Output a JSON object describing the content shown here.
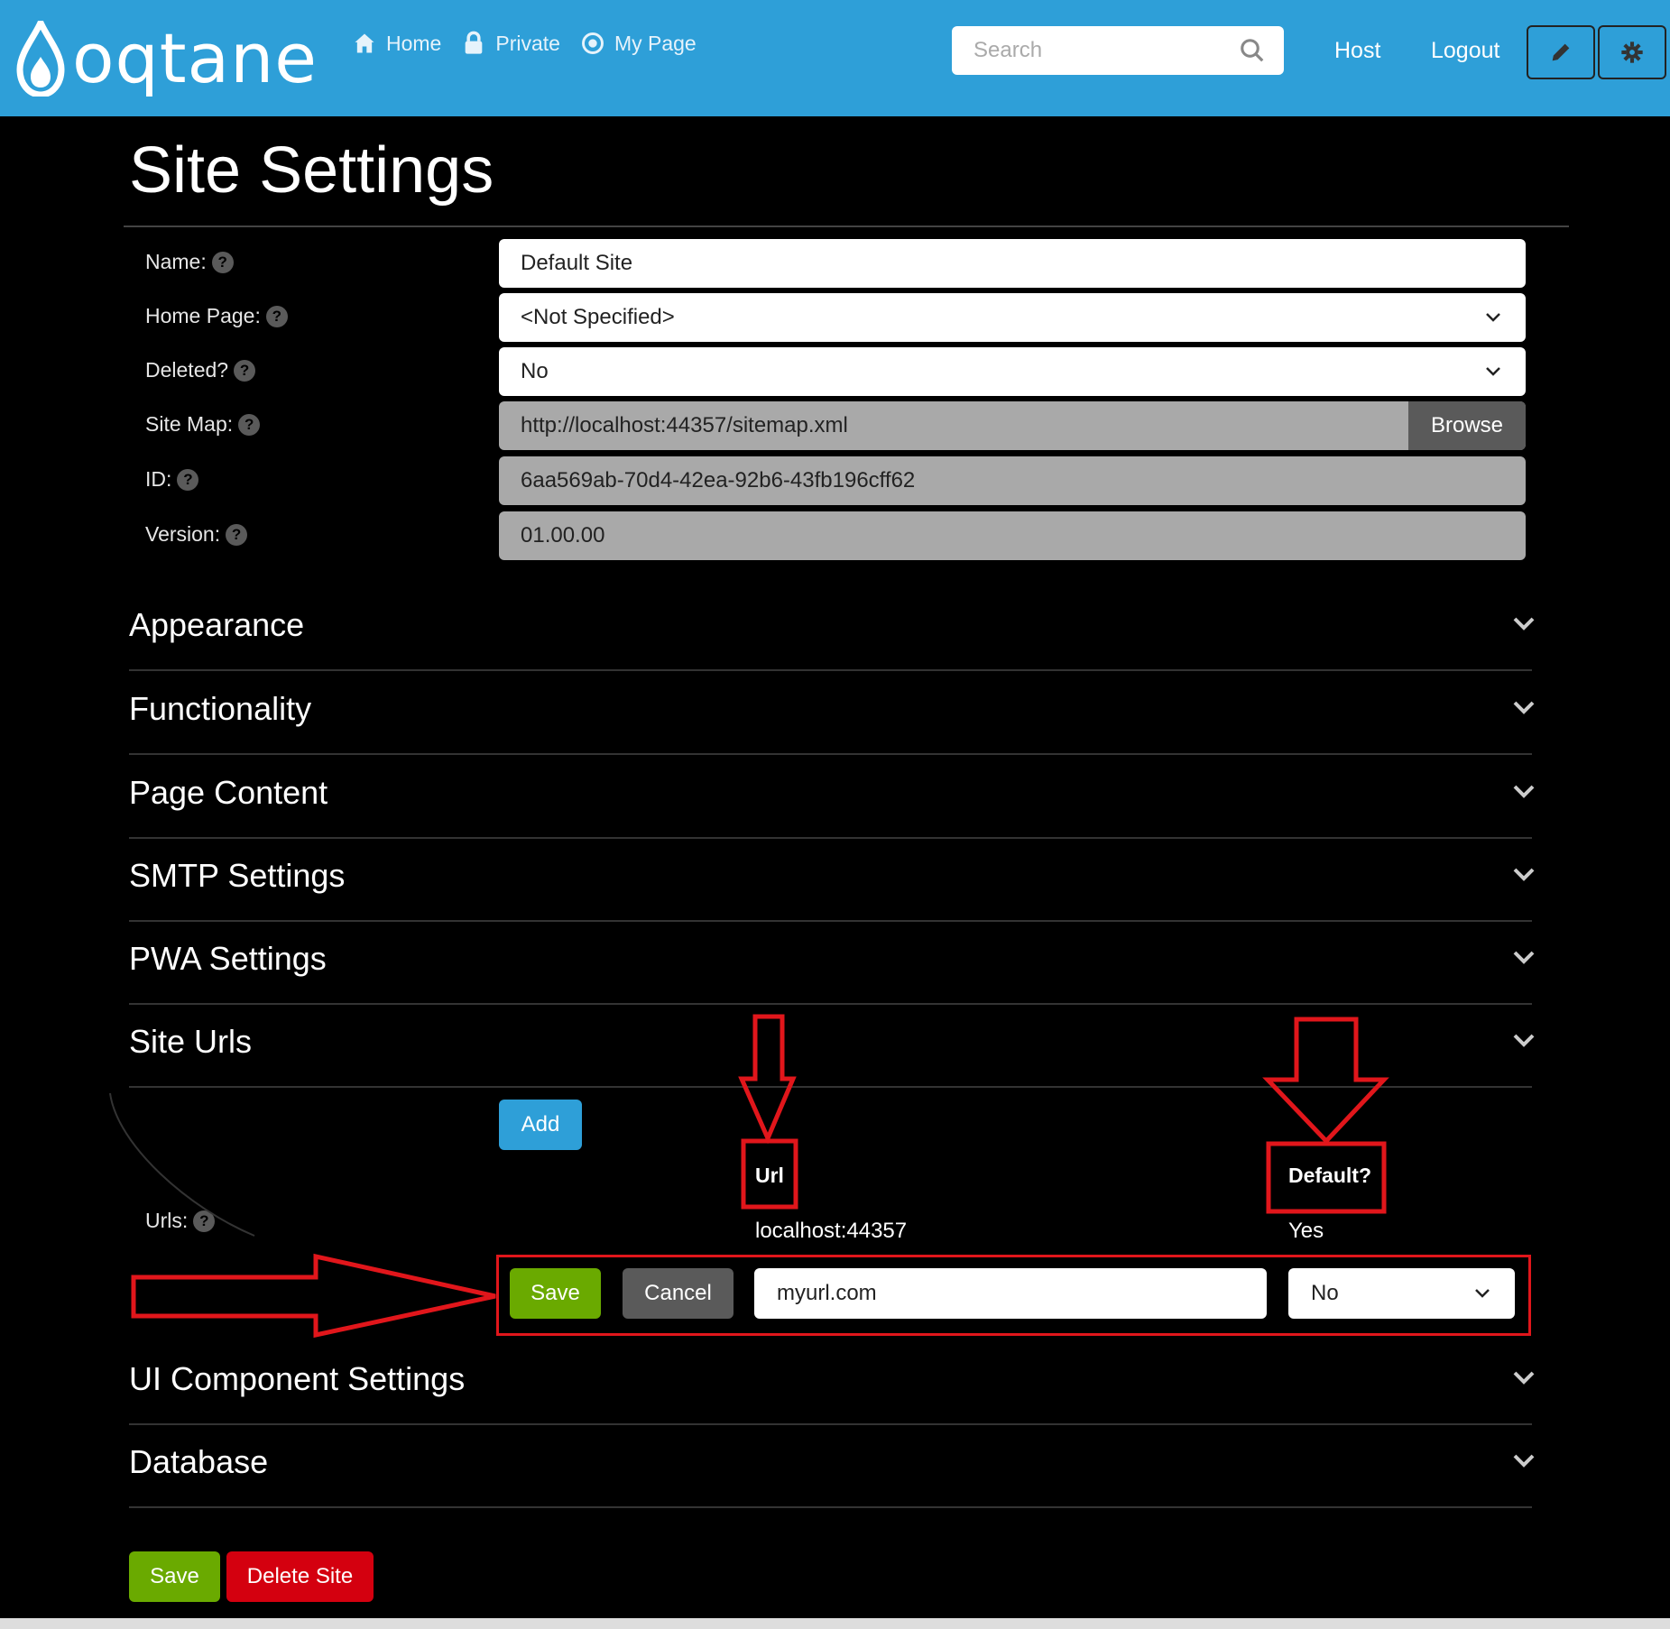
{
  "brand": {
    "logo_text": "oqtane",
    "accent": "#2e9fd8"
  },
  "nav": {
    "links": [
      {
        "label": "Home",
        "icon": "home-icon"
      },
      {
        "label": "Private",
        "icon": "lock-icon"
      },
      {
        "label": "My Page",
        "icon": "target-icon"
      }
    ],
    "search_placeholder": "Search",
    "host_label": "Host",
    "logout_label": "Logout",
    "edit_icon": "pencil-icon",
    "settings_icon": "gear-icon"
  },
  "page": {
    "title": "Site Settings",
    "fields": {
      "name": {
        "label": "Name:",
        "value": "Default Site"
      },
      "home_page": {
        "label": "Home Page:",
        "value": "<Not Specified>"
      },
      "deleted": {
        "label": "Deleted?",
        "value": "No"
      },
      "site_map": {
        "label": "Site Map:",
        "value": "http://localhost:44357/sitemap.xml",
        "button": "Browse"
      },
      "id": {
        "label": "ID:",
        "value": "6aa569ab-70d4-42ea-92b6-43fb196cff62"
      },
      "version": {
        "label": "Version:",
        "value": "01.00.00"
      }
    },
    "sections": [
      "Appearance",
      "Functionality",
      "Page Content",
      "SMTP Settings",
      "PWA Settings",
      "Site Urls",
      "UI Component Settings",
      "Database"
    ],
    "site_urls": {
      "add_label": "Add",
      "urls_label": "Urls:",
      "columns": {
        "url": "Url",
        "default": "Default?"
      },
      "rows": [
        {
          "url": "localhost:44357",
          "default": "Yes"
        }
      ],
      "edit_row": {
        "save_label": "Save",
        "cancel_label": "Cancel",
        "url_value": "myurl.com",
        "default_value": "No"
      }
    },
    "actions": {
      "save_label": "Save",
      "delete_label": "Delete Site"
    }
  }
}
